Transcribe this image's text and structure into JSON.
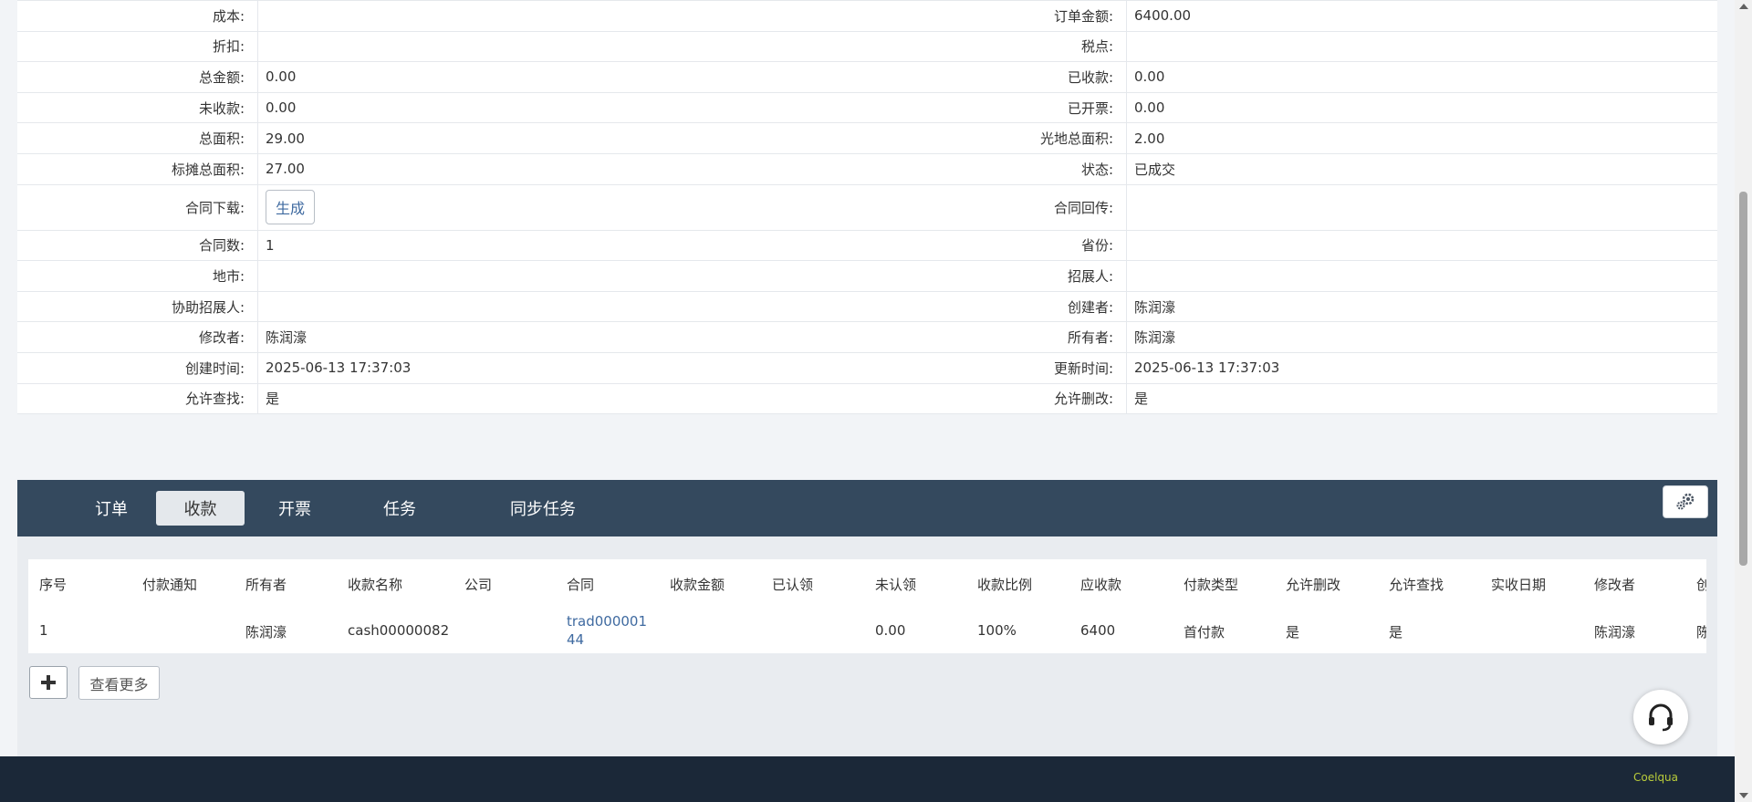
{
  "details": [
    {
      "l1": "成本:",
      "v1": "",
      "l2": "订单金额:",
      "v2": "6400.00"
    },
    {
      "l1": "折扣:",
      "v1": "",
      "l2": "税点:",
      "v2": ""
    },
    {
      "l1": "总金额:",
      "v1": "0.00",
      "l2": "已收款:",
      "v2": "0.00"
    },
    {
      "l1": "未收款:",
      "v1": "0.00",
      "l2": "已开票:",
      "v2": "0.00"
    },
    {
      "l1": "总面积:",
      "v1": "29.00",
      "l2": "光地总面积:",
      "v2": "2.00"
    },
    {
      "l1": "标摊总面积:",
      "v1": "27.00",
      "l2": "状态:",
      "v2": "已成交"
    },
    {
      "l1": "合同下载:",
      "v1": "",
      "l2": "合同回传:",
      "v2": ""
    },
    {
      "l1": "合同数:",
      "v1": "1",
      "l2": "省份:",
      "v2": ""
    },
    {
      "l1": "地市:",
      "v1": "",
      "l2": "招展人:",
      "v2": ""
    },
    {
      "l1": "协助招展人:",
      "v1": "",
      "l2": "创建者:",
      "v2": "陈润濠"
    },
    {
      "l1": "修改者:",
      "v1": "陈润濠",
      "l2": "所有者:",
      "v2": "陈润濠"
    },
    {
      "l1": "创建时间:",
      "v1": "2025-06-13 17:37:03",
      "l2": "更新时间:",
      "v2": "2025-06-13 17:37:03"
    },
    {
      "l1": "允许查找:",
      "v1": "是",
      "l2": "允许删改:",
      "v2": "是"
    }
  ],
  "generate_label": "生成",
  "tabs": [
    "订单",
    "收款",
    "开票",
    "任务",
    "同步任务"
  ],
  "columns": [
    "序号",
    "付款通知",
    "所有者",
    "收款名称",
    "公司",
    "合同",
    "收款金额",
    "已认领",
    "未认领",
    "收款比例",
    "应收款",
    "付款类型",
    "允许删改",
    "允许查找",
    "实收日期",
    "修改者",
    "创"
  ],
  "rows": [
    [
      "1",
      "",
      "陈润濠",
      "cash00000082",
      "",
      "trad00000144",
      "",
      "",
      "0.00",
      "100%",
      "6400",
      "首付款",
      "是",
      "是",
      "",
      "陈润濠",
      "陈"
    ]
  ],
  "more_label": "查看更多",
  "brand": "Coelqua",
  "colors": {
    "tabbar": "#34495e",
    "footer": "#1b2838",
    "link": "#3f6aa0"
  }
}
